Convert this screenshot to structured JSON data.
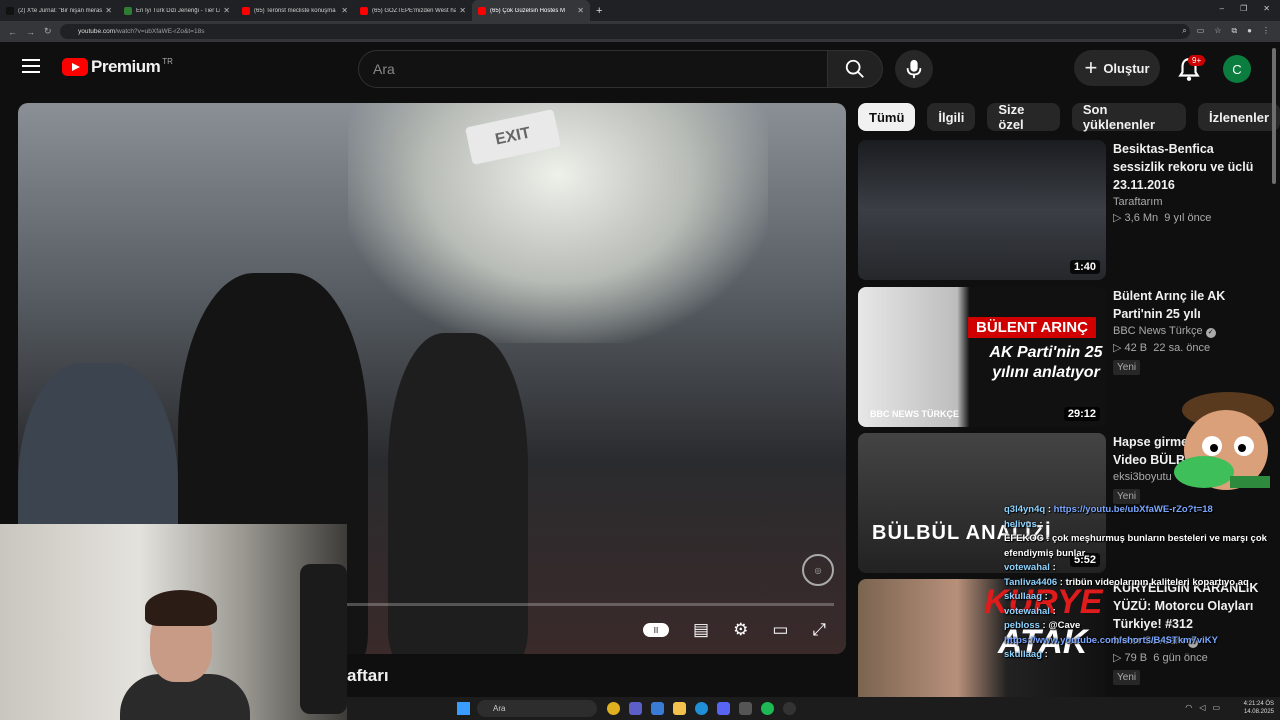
{
  "browser": {
    "tabs": [
      {
        "title": "(2) X'te Jurnal: \"Bir nişan merasim",
        "color": "#111111"
      },
      {
        "title": "En İyi Türk Dizi Jeneriği - Tier List",
        "color": "#2e7d32"
      },
      {
        "title": "(65) Terörist mecliste konuşma",
        "color": "#ff0000"
      },
      {
        "title": "(65) GÖZTEPE'mizden West ha",
        "color": "#ff0000"
      },
      {
        "title": "(65) Çok Güzelsin Hostes M",
        "color": "#ff0000",
        "active": true
      }
    ],
    "url_host": "youtube.com",
    "url_path": "/watch?v=ubXfaWE-rZo&t=18s"
  },
  "youtube": {
    "logo_text": "Premium",
    "logo_region": "TR",
    "search_placeholder": "Ara",
    "create_label": "Oluştur",
    "notif_badge": "9+",
    "avatar_letter": "C"
  },
  "player": {
    "exit_sign": "EXIT",
    "progress": 0.03
  },
  "video_title_fragment": "aftarı",
  "chips": [
    "Tümü",
    "İlgili",
    "Size özel",
    "Son yüklenenler",
    "İzlenenler"
  ],
  "recommendations": [
    {
      "title": "Besiktas-Benfica sessizlik rekoru ve üclü 23.11.2016",
      "channel": "Taraftarım",
      "views": "3,6 Mn",
      "age": "9 yıl önce",
      "duration": "1:40",
      "verified": false,
      "new": ""
    },
    {
      "title": "Bülent Arınç ile AK Parti'nin 25 yılı",
      "channel": "BBC News Türkçe",
      "views": "42 B",
      "age": "22 sa. önce",
      "duration": "29:12",
      "verified": true,
      "new": "Yeni",
      "thumb_red": "BÜLENT ARINÇ",
      "thumb_sub": "AK Parti'nin 25 yılını anlatıyor",
      "thumb_brand": "BBC NEWS TÜRKÇE"
    },
    {
      "title": "Hapse girmesi olan Video BÜLBÜL (F",
      "channel": "eksi3boyutu",
      "views": "",
      "age": "",
      "duration": "5:52",
      "verified": false,
      "new": "Yeni",
      "thumb_big": "BÜLBÜL ANALİZİ"
    },
    {
      "title": "KURYELİĞİN KARANLIK YÜZÜ: Motorcu Olayları Türkiye! #312",
      "channel": "Motor Sevdam",
      "views": "79 B",
      "age": "6 gün önce",
      "duration": "",
      "verified": true,
      "new": "Yeni",
      "thumb_kurye": "KURYE",
      "thumb_atak": "ATAK"
    }
  ],
  "chat": [
    {
      "user": "q3l4yn4q",
      "msg": "https://youtu.be/ubXfaWE-rZo?t=18",
      "link": true
    },
    {
      "user": "helivus",
      "msg": "",
      "link": false
    },
    {
      "user": "",
      "msg": "EFEKOC : çok meşhurmuş bunların besteleri ve marşı çok efendiymiş bunlar",
      "link": false
    },
    {
      "user": "votewahal",
      "msg": "",
      "link": false
    },
    {
      "user": "Tanliva4406",
      "msg": "tribün videolarının kaliteleri kopartıyo aq",
      "link": false
    },
    {
      "user": "skullaag",
      "msg": "",
      "link": false
    },
    {
      "user": "votewahal",
      "msg": "",
      "link": false
    },
    {
      "user": "pebloss",
      "msg": "@Cave",
      "link": false
    },
    {
      "user": "",
      "msg": "https://www.youtube.com/shorts/B4STkm7viKY",
      "link": true
    },
    {
      "user": "skullaag",
      "msg": "",
      "link": false
    }
  ],
  "taskbar": {
    "search": "Ara",
    "time": "4:21:24 ÖS",
    "date": "14.08.2025"
  },
  "controls": {
    "pause": "II"
  }
}
